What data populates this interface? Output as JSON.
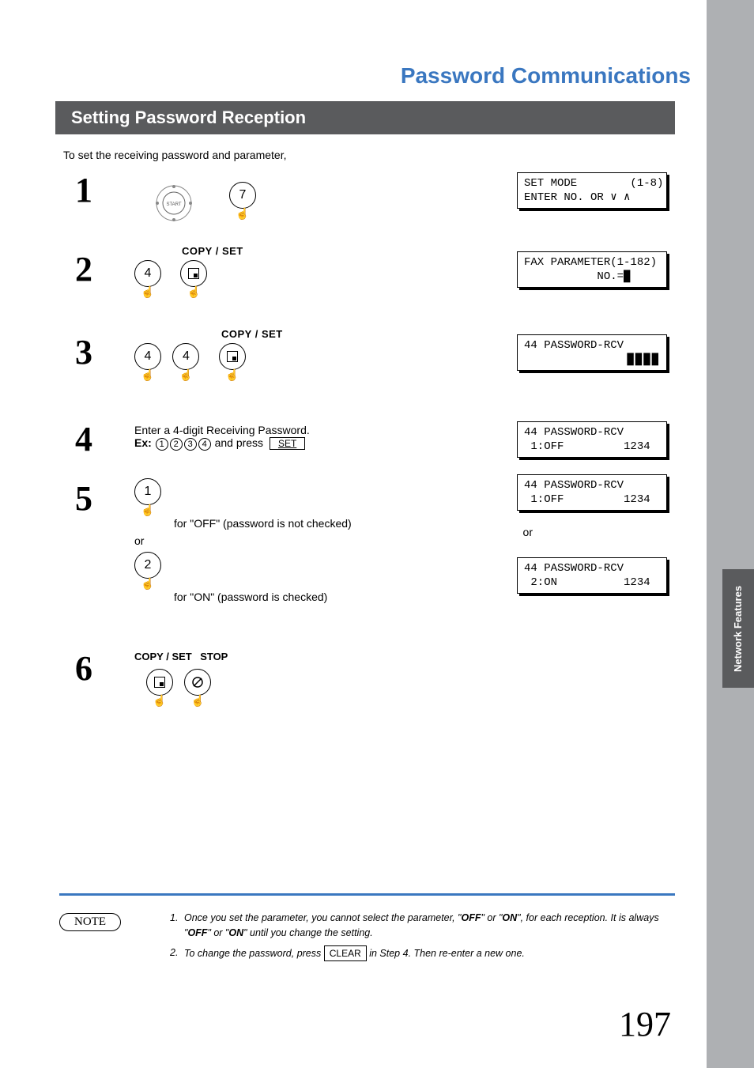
{
  "page_title": "Password Communications",
  "section_title": "Setting Password Reception",
  "intro": "To set the receiving password and parameter,",
  "side_tab": "Network Features",
  "page_number": "197",
  "steps": {
    "s1": {
      "num": "1",
      "dial_key": "7",
      "lcd_l1": "SET MODE        (1-8)",
      "lcd_l2": "ENTER NO. OR ∨ ∧"
    },
    "s2": {
      "num": "2",
      "copyset": "COPY / SET",
      "key": "4",
      "lcd_l1": "FAX PARAMETER(1-182)",
      "lcd_l2": "           NO.=█"
    },
    "s3": {
      "num": "3",
      "copyset": "COPY / SET",
      "keyA": "4",
      "keyB": "4",
      "lcd_l1": "44 PASSWORD-RCV",
      "lcd_l2": "                 ",
      "masked": "████"
    },
    "s4": {
      "num": "4",
      "line1": "Enter a 4-digit Receiving Password.",
      "ex_label": "Ex:",
      "d1": "1",
      "d2": "2",
      "d3": "3",
      "d4": "4",
      "and_press": " and press ",
      "set_btn": "SET",
      "lcd_l1": "44 PASSWORD-RCV",
      "lcd_l2": " 1:OFF         1234"
    },
    "s5": {
      "num": "5",
      "keyOff": "1",
      "keyOn": "2",
      "offText": "for \"OFF\" (password is not checked)",
      "or": "or",
      "onText": "for \"ON\" (password is checked)",
      "lcdA_l1": "44 PASSWORD-RCV",
      "lcdA_l2": " 1:OFF         1234",
      "lcd_or": "or",
      "lcdB_l1": "44 PASSWORD-RCV",
      "lcdB_l2": " 2:ON          1234"
    },
    "s6": {
      "num": "6",
      "copyset": "COPY / SET",
      "stop": "STOP"
    }
  },
  "note_label": "NOTE",
  "notes": {
    "n1_num": "1.",
    "n1_a": "Once you set the parameter, you cannot select the parameter, \"",
    "n1_off": "OFF",
    "n1_b": "\" or \"",
    "n1_on": "ON",
    "n1_c": "\", for each reception.  It is always \"",
    "n1_off2": "OFF",
    "n1_d": "\" or \"",
    "n1_on2": "ON",
    "n1_e": "\" until you change the setting.",
    "n2_num": "2.",
    "n2_a": "To change the password, press ",
    "n2_clear": "CLEAR",
    "n2_b": " in Step 4. Then re-enter a new one."
  }
}
